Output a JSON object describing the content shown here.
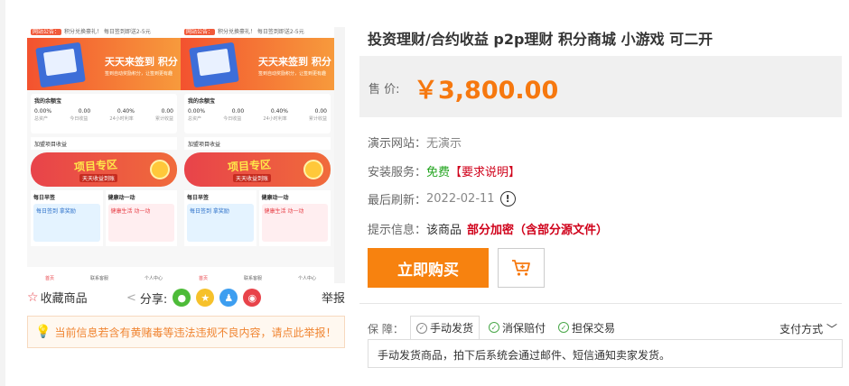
{
  "gallery": {
    "screens": [
      {
        "notice_tag": "网站公告：",
        "notice_text": "积分兑换豪礼！ 每日签到即送2-5元",
        "banner_title": "天天来签到  积分",
        "banner_sub": "签到自动奖励积分，让签到更有趣",
        "card_title": "我的余额宝",
        "stats_values": [
          "0.00%",
          "0.00",
          "0.40%",
          "0.00"
        ],
        "stats_labels": [
          "总资产",
          "今日收益",
          "24小时利率",
          "累计收益"
        ],
        "line_text": "加盟项目收益",
        "zone_title": "项目专区",
        "zone_sub": "天天收益到账",
        "grid_left_title": "每日早签",
        "grid_left_tile": "每日签到 拿奖励",
        "grid_right_title": "健康动一动",
        "grid_right_tile": "健康生活 动一动",
        "tabbar": [
          "首页",
          "联系客服",
          "个人中心"
        ]
      },
      {
        "notice_tag": "网站公告：",
        "notice_text": "积分兑换豪礼！ 每日签到即送2-5元",
        "banner_title": "天天来签到  积分",
        "banner_sub": "签到自动奖励积分，让签到更有趣",
        "card_title": "我的余额宝",
        "stats_values": [
          "0.00%",
          "0.00",
          "0.40%",
          "0.00"
        ],
        "stats_labels": [
          "总资产",
          "今日收益",
          "24小时利率",
          "累计收益"
        ],
        "line_text": "加盟项目收益",
        "zone_title": "项目专区",
        "zone_sub": "天天收益到账",
        "grid_left_title": "每日早签",
        "grid_left_tile": "每日签到 拿奖励",
        "grid_right_title": "健康动一动",
        "grid_right_tile": "健康生活 动一动",
        "tabbar": [
          "首页",
          "联系客服",
          "个人中心"
        ]
      }
    ]
  },
  "actions": {
    "favorite": "收藏商品",
    "share_label": "分享:",
    "report": "举报"
  },
  "notice": "当前信息若含有黄赌毒等违法违规不良内容，请点此举报！",
  "product": {
    "title": "投资理财/合约收益 p2p理财 积分商城 小游戏 可二开",
    "price_label": "售 价:",
    "price": "￥3,800.00",
    "demo_label": "演示网站：",
    "demo_value": "无演示",
    "install_label": "安装服务：",
    "install_free": "免费",
    "install_req": "【要求说明】",
    "refresh_label": "最后刷新：",
    "refresh_value": "2022-02-11",
    "tip_label": "提示信息：",
    "tip_value": "该商品",
    "tip_enc": "部分加密（含部分源文件）",
    "buy_label": "立即购买"
  },
  "guarantee": {
    "label": "保 障：",
    "tabs": [
      "手动发货",
      "消保赔付",
      "担保交易"
    ],
    "pay_method": "支付方式",
    "content": "手动发货商品，拍下后系统会通过邮件、短信通知卖家发货。"
  },
  "colors": {
    "price": "#f6780f",
    "buy": "#f7820f",
    "warning": "#d0021b",
    "free": "#20a31c"
  }
}
